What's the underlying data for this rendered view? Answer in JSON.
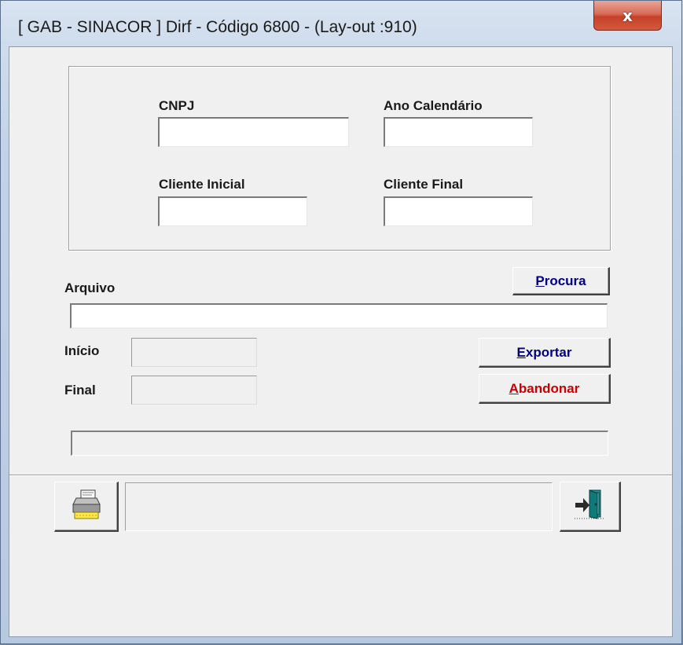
{
  "window": {
    "title": "[ GAB - SINACOR  ] Dirf - Código 6800 - (Lay-out :910)",
    "close_label": "x"
  },
  "filters": {
    "cnpj_label": "CNPJ",
    "cnpj_value": "",
    "ano_label": "Ano Calendário",
    "ano_value": "",
    "cliente_inicial_label": "Cliente Inicial",
    "cliente_inicial_value": "",
    "cliente_final_label": "Cliente Final",
    "cliente_final_value": ""
  },
  "arquivo": {
    "label": "Arquivo",
    "value": "",
    "procura_mnemonic": "P",
    "procura_rest": "rocura"
  },
  "periodo": {
    "inicio_label": "Início",
    "inicio_value": "",
    "final_label": "Final",
    "final_value": ""
  },
  "actions": {
    "exportar_mnemonic": "E",
    "exportar_rest": "xportar",
    "abandonar_mnemonic": "A",
    "abandonar_rest": "bandonar",
    "link_color": "#000080",
    "danger_color": "#cc0000"
  },
  "toolbar": {
    "print_icon": "printer-icon",
    "exit_icon": "exit-door-icon",
    "status_text": ""
  }
}
